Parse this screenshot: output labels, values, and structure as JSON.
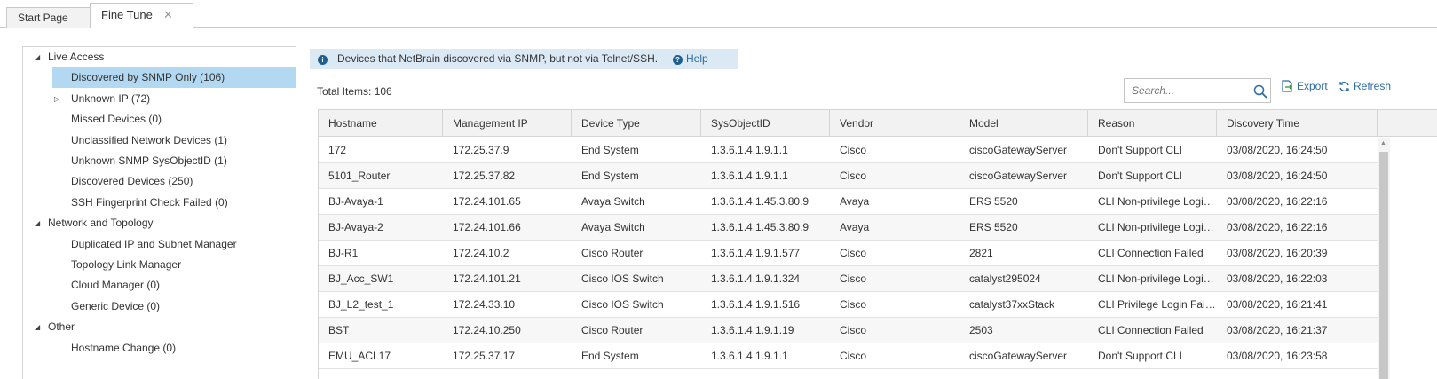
{
  "tabs": [
    {
      "label": "Start Page",
      "active": false
    },
    {
      "label": "Fine Tune",
      "active": true,
      "close": "✕"
    }
  ],
  "tree": [
    {
      "label": "Live Access",
      "level": 0,
      "expander": "expanded"
    },
    {
      "label": "Discovered by SNMP Only (106)",
      "level": 1,
      "selected": true
    },
    {
      "label": "Unknown IP (72)",
      "level": 1,
      "expander": "collapsed"
    },
    {
      "label": "Missed Devices (0)",
      "level": 1
    },
    {
      "label": "Unclassified Network Devices (1)",
      "level": 1
    },
    {
      "label": "Unknown SNMP SysObjectID (1)",
      "level": 1
    },
    {
      "label": "Discovered Devices (250)",
      "level": 1
    },
    {
      "label": "SSH Fingerprint Check Failed (0)",
      "level": 1
    },
    {
      "label": "Network and Topology",
      "level": 0,
      "expander": "expanded"
    },
    {
      "label": "Duplicated IP and Subnet Manager",
      "level": 1
    },
    {
      "label": "Topology Link Manager",
      "level": 1
    },
    {
      "label": "Cloud Manager (0)",
      "level": 1
    },
    {
      "label": "Generic Device (0)",
      "level": 1
    },
    {
      "label": "Other",
      "level": 0,
      "expander": "expanded"
    },
    {
      "label": "Hostname Change (0)",
      "level": 1
    }
  ],
  "info": {
    "message": "Devices that NetBrain discovered via SNMP, but not via Telnet/SSH.",
    "help_label": "Help",
    "info_icon": "info-icon",
    "help_icon": "help-icon"
  },
  "total_items": "Total Items: 106",
  "search": {
    "placeholder": "Search..."
  },
  "toolbar": {
    "export_label": "Export",
    "refresh_label": "Refresh"
  },
  "colors": {
    "accent": "#2b6ca3",
    "selected": "#b3d8f1",
    "info_bg": "#dbe9f4"
  },
  "table": {
    "columns": [
      "Hostname",
      "Management IP",
      "Device Type",
      "SysObjectID",
      "Vendor",
      "Model",
      "Reason",
      "Discovery Time"
    ],
    "rows": [
      [
        "172",
        "172.25.37.9",
        "End System",
        "1.3.6.1.4.1.9.1.1",
        "Cisco",
        "ciscoGatewayServer",
        "Don't Support CLI",
        "03/08/2020, 16:24:50"
      ],
      [
        "5101_Router",
        "172.25.37.82",
        "End System",
        "1.3.6.1.4.1.9.1.1",
        "Cisco",
        "ciscoGatewayServer",
        "Don't Support CLI",
        "03/08/2020, 16:24:50"
      ],
      [
        "BJ-Avaya-1",
        "172.24.101.65",
        "Avaya Switch",
        "1.3.6.1.4.1.45.3.80.9",
        "Avaya",
        "ERS 5520",
        "CLI Non-privilege Login...",
        "03/08/2020, 16:22:16"
      ],
      [
        "BJ-Avaya-2",
        "172.24.101.66",
        "Avaya Switch",
        "1.3.6.1.4.1.45.3.80.9",
        "Avaya",
        "ERS 5520",
        "CLI Non-privilege Login...",
        "03/08/2020, 16:22:16"
      ],
      [
        "BJ-R1",
        "172.24.10.2",
        "Cisco Router",
        "1.3.6.1.4.1.9.1.577",
        "Cisco",
        "2821",
        "CLI Connection Failed",
        "03/08/2020, 16:20:39"
      ],
      [
        "BJ_Acc_SW1",
        "172.24.101.21",
        "Cisco IOS Switch",
        "1.3.6.1.4.1.9.1.324",
        "Cisco",
        "catalyst295024",
        "CLI Non-privilege Login...",
        "03/08/2020, 16:22:03"
      ],
      [
        "BJ_L2_test_1",
        "172.24.33.10",
        "Cisco IOS Switch",
        "1.3.6.1.4.1.9.1.516",
        "Cisco",
        "catalyst37xxStack",
        "CLI Privilege Login Failed",
        "03/08/2020, 16:21:41"
      ],
      [
        "BST",
        "172.24.10.250",
        "Cisco Router",
        "1.3.6.1.4.1.9.1.19",
        "Cisco",
        "2503",
        "CLI Connection Failed",
        "03/08/2020, 16:21:37"
      ],
      [
        "EMU_ACL17",
        "172.25.37.17",
        "End System",
        "1.3.6.1.4.1.9.1.1",
        "Cisco",
        "ciscoGatewayServer",
        "Don't Support CLI",
        "03/08/2020, 16:23:58"
      ]
    ]
  }
}
